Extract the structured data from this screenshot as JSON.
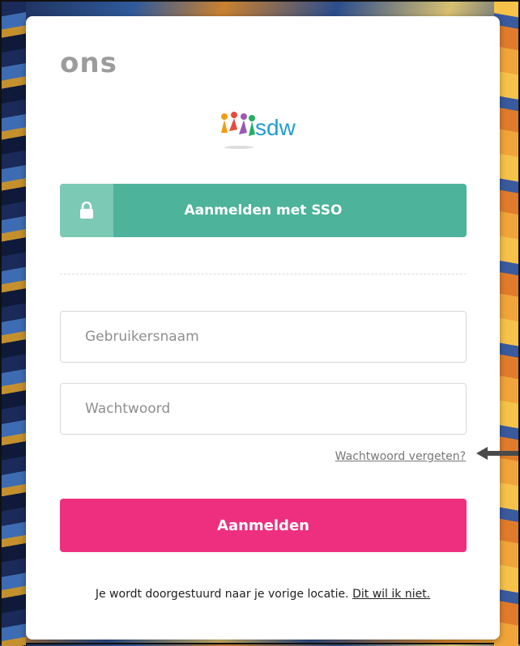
{
  "brand": {
    "name": "ons",
    "color": "#9c9c9c"
  },
  "logo": {
    "text": "sdw",
    "icon": "people-figures-icon"
  },
  "sso": {
    "label": "Aanmelden met SSO",
    "icon": "lock-icon",
    "color": "#4db39a"
  },
  "form": {
    "username_placeholder": "Gebruikersnaam",
    "password_placeholder": "Wachtwoord",
    "forgot_password": "Wachtwoord vergeten?",
    "submit_label": "Aanmelden",
    "submit_color": "#ee2f7f"
  },
  "redirect": {
    "message": "Je wordt doorgestuurd naar je vorige locatie.",
    "optout_link": "Dit wil ik niet."
  },
  "annotation": {
    "icon": "arrow-left-icon"
  }
}
